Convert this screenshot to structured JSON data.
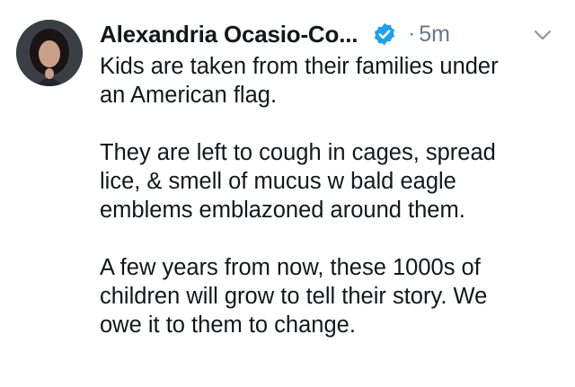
{
  "tweet": {
    "author_name": "Alexandria Ocasio-Co...",
    "verified_icon": "verified-badge-icon",
    "separator": "·",
    "time": "5m",
    "menu_icon": "chevron-down-icon",
    "paragraphs": [
      [
        "Kids are taken from their families under",
        "an American flag."
      ],
      [
        "They are left to cough in cages, spread",
        "lice, & smell of mucus w bald eagle",
        "emblems emblazoned around them."
      ],
      [
        "A few years from now, these 1000s of",
        "children will grow to tell their story. We",
        "owe it to them to change."
      ]
    ]
  },
  "colors": {
    "text": "#14171a",
    "secondary": "#657786",
    "verified": "#1da1f2"
  }
}
